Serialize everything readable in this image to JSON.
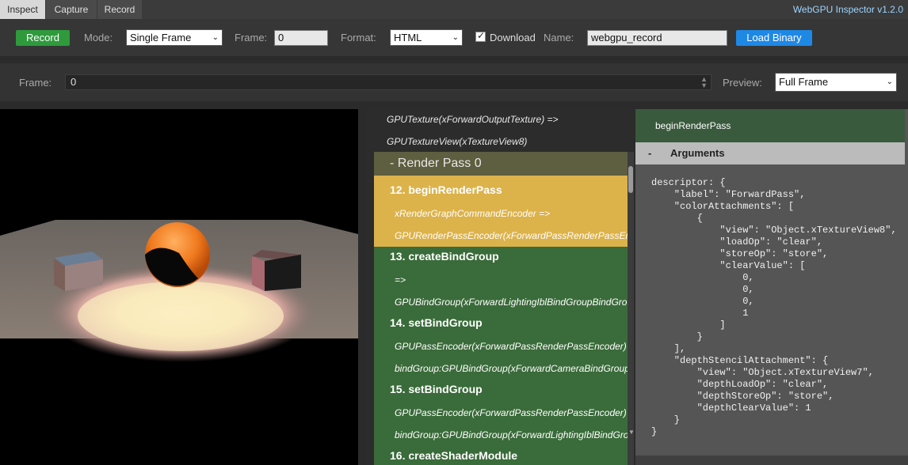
{
  "tabs": [
    {
      "label": "Inspect",
      "active": true
    },
    {
      "label": "Capture",
      "active": false
    },
    {
      "label": "Record",
      "active": false
    }
  ],
  "app_title": "WebGPU Inspector v1.2.0",
  "toolbar": {
    "record_label": "Record",
    "mode_label": "Mode:",
    "mode_value": "Single Frame",
    "frame_label": "Frame:",
    "frame_value": "0",
    "format_label": "Format:",
    "format_value": "HTML",
    "download_label": "Download",
    "download_checked": true,
    "name_label": "Name:",
    "name_value": "webgpu_record",
    "load_label": "Load Binary"
  },
  "framebar": {
    "frame_label": "Frame:",
    "frame_value": "0",
    "preview_label": "Preview:",
    "preview_value": "Full Frame"
  },
  "commands": {
    "pre_lines": [
      "GPUTexture(xForwardOutputTexture) =>",
      "GPUTextureView(xTextureView8)"
    ],
    "render_pass": "-   Render Pass 0",
    "items": [
      {
        "title": "12. beginRenderPass",
        "lines": [
          "xRenderGraphCommandEncoder =>",
          "GPURenderPassEncoder(xForwardPassRenderPassEncoder)"
        ],
        "selected": true
      },
      {
        "title": "13. createBindGroup",
        "lines": [
          "=>",
          "GPUBindGroup(xForwardLightingIblBindGroupBindGroup)"
        ],
        "selected": false
      },
      {
        "title": "14. setBindGroup",
        "lines": [
          "GPUPassEncoder(xForwardPassRenderPassEncoder) index",
          "bindGroup:GPUBindGroup(xForwardCameraBindGroupBindGroup)"
        ],
        "selected": false
      },
      {
        "title": "15. setBindGroup",
        "lines": [
          "GPUPassEncoder(xForwardPassRenderPassEncoder) index",
          "bindGroup:GPUBindGroup(xForwardLightingIblBindGroupBindGroup)"
        ],
        "selected": false
      },
      {
        "title": "16. createShaderModule",
        "lines": [],
        "selected": false
      }
    ]
  },
  "details": {
    "header": "beginRenderPass",
    "section_toggle": "-",
    "section_title": "Arguments",
    "code_lines": [
      "descriptor: {",
      "    \"label\": \"ForwardPass\",",
      "    \"colorAttachments\": [",
      "        {",
      "            \"view\": \"Object.xTextureView8\",",
      "            \"loadOp\": \"clear\",",
      "            \"storeOp\": \"store\",",
      "            \"clearValue\": [",
      "                0,",
      "                0,",
      "                0,",
      "                1",
      "            ]",
      "        }",
      "    ],",
      "    \"depthStencilAttachment\": {",
      "        \"view\": \"Object.xTextureView7\",",
      "        \"depthLoadOp\": \"clear\",",
      "        \"depthStoreOp\": \"store\",",
      "        \"depthClearValue\": 1",
      "    }",
      "}"
    ]
  },
  "colors": {
    "record_button": "#2e9a3c",
    "load_button": "#1e88e5",
    "selected_command": "#dcb24a",
    "command_block": "#3a6b3a",
    "title_accent": "#9cd4ff"
  }
}
